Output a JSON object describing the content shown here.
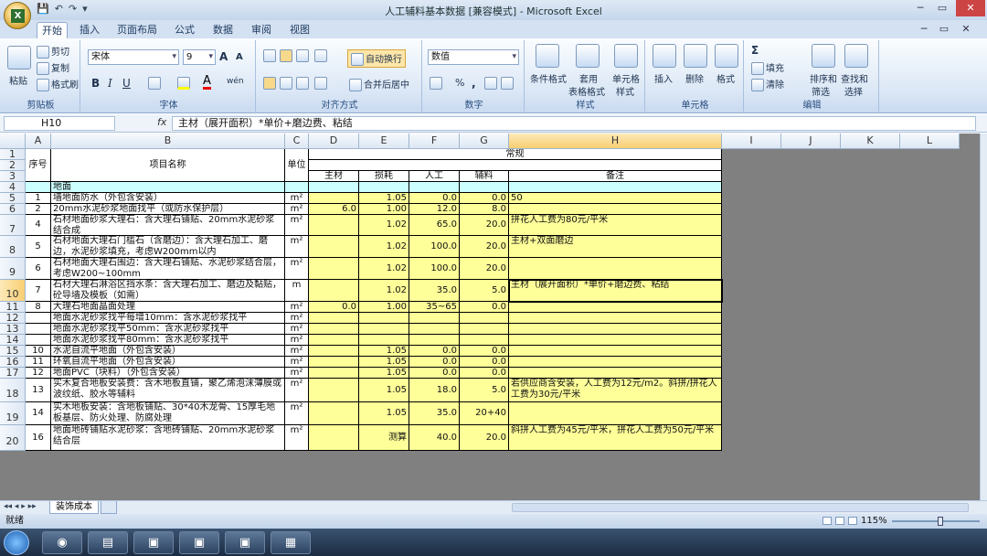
{
  "window": {
    "title": "人工辅料基本数据 [兼容模式] - Microsoft Excel",
    "office_logo": "X",
    "qat": [
      "💾",
      "↶",
      "↷",
      "▾"
    ],
    "controls": [
      "─",
      "▭",
      "✕",
      "─",
      "▭",
      "✕"
    ]
  },
  "tabs": [
    "开始",
    "插入",
    "页面布局",
    "公式",
    "数据",
    "审阅",
    "视图"
  ],
  "ribbon": {
    "clipboard": {
      "paste": "粘贴",
      "cut": "剪切",
      "copy": "复制",
      "format_painter": "格式刷",
      "label": "剪贴板"
    },
    "font": {
      "name": "宋体",
      "size": "9",
      "grow": "A",
      "shrink": "A",
      "bold": "B",
      "italic": "I",
      "underline": "U",
      "wen": "wén",
      "label": "字体"
    },
    "alignment": {
      "wrap": "自动换行",
      "merge": "合并后居中",
      "label": "对齐方式"
    },
    "number": {
      "format": "数值",
      "percent": "%",
      "comma": ",",
      "label": "数字"
    },
    "styles": {
      "conditional": "条件格式",
      "table_format_1": "套用",
      "table_format_2": "表格格式",
      "cell_style_1": "单元格",
      "cell_style_2": "样式",
      "label": "样式"
    },
    "cells": {
      "insert": "插入",
      "delete": "删除",
      "format": "格式",
      "label": "单元格"
    },
    "editing": {
      "autosum": "Σ",
      "fill": "填充",
      "clear": "清除",
      "sort_1": "排序和",
      "sort_2": "筛选",
      "find_1": "查找和",
      "find_2": "选择",
      "label": "编辑"
    }
  },
  "formula_bar": {
    "name_box": "H10",
    "fx": "fx",
    "formula": "主材（展开面积）*单价+磨边费、粘结"
  },
  "columns": [
    "A",
    "B",
    "C",
    "D",
    "E",
    "F",
    "G",
    "H",
    "I",
    "J",
    "K",
    "L"
  ],
  "rows": [
    {
      "n": "1",
      "cells": {
        "A": "序号",
        "B": "项目名称",
        "C": "单位",
        "D": "",
        "E": "",
        "F": "",
        "G": "",
        "H": "常规"
      }
    },
    {
      "n": "2",
      "cells": {}
    },
    {
      "n": "3",
      "cells": {
        "D": "主材",
        "E": "损耗",
        "F": "人工",
        "G": "辅料",
        "H": "备注"
      }
    },
    {
      "n": "4",
      "cells": {
        "A": "",
        "B": "地面",
        "C": "",
        "D": "",
        "E": "",
        "F": "",
        "G": "",
        "H": ""
      }
    },
    {
      "n": "5",
      "cells": {
        "A": "1",
        "B": "墙地面防水（外包含安装）",
        "C": "m²",
        "D": "",
        "E": "1.05",
        "F": "0.0",
        "G": "0.0",
        "H": "50"
      }
    },
    {
      "n": "6",
      "cells": {
        "A": "2",
        "B": "20mm水泥砂浆地面找平（或防水保护层）",
        "C": "m²",
        "D": "6.0",
        "E": "1.00",
        "F": "12.0",
        "G": "8.0",
        "H": ""
      }
    },
    {
      "n": "7",
      "cells": {
        "A": "4",
        "B": "石材地面砂浆大理石：含大理石铺贴、20mm水泥砂浆结合成",
        "C": "m²",
        "D": "",
        "E": "1.02",
        "F": "65.0",
        "G": "20.0",
        "H": "拼花人工费为80元/平米"
      }
    },
    {
      "n": "8",
      "cells": {
        "A": "5",
        "B": "石材地面大理石门槛石（含磨边）：含大理石加工、磨边，水泥砂浆填充，考虑W200mm以内",
        "C": "m²",
        "D": "",
        "E": "1.02",
        "F": "100.0",
        "G": "20.0",
        "H": "主材+双面磨边"
      }
    },
    {
      "n": "9",
      "cells": {
        "A": "6",
        "B": "石材地面大理石围边：含大理石铺贴、水泥砂浆结合层，考虑W200~100mm",
        "C": "m²",
        "D": "",
        "E": "1.02",
        "F": "100.0",
        "G": "20.0",
        "H": ""
      }
    },
    {
      "n": "10",
      "cells": {
        "A": "7",
        "B": "石材大理石淋浴区挡水条：含大理石加工、磨边及黏贴，砼导墙及模板（如需）",
        "C": "m",
        "D": "",
        "E": "1.02",
        "F": "35.0",
        "G": "5.0",
        "H": "主材（展开面积）*单价+磨边费、粘结"
      }
    },
    {
      "n": "11",
      "cells": {
        "A": "8",
        "B": "大理石地面晶面处理",
        "C": "m²",
        "D": "0.0",
        "E": "1.00",
        "F": "35~65",
        "G": "0.0",
        "H": ""
      }
    },
    {
      "n": "12",
      "cells": {
        "A": "",
        "B": "地面水泥砂浆找平每增10mm：含水泥砂浆找平",
        "C": "m²",
        "D": "",
        "E": "",
        "F": "",
        "G": "",
        "H": ""
      }
    },
    {
      "n": "13",
      "cells": {
        "A": "",
        "B": "地面水泥砂浆找平50mm：含水泥砂浆找平",
        "C": "m²",
        "D": "",
        "E": "",
        "F": "",
        "G": "",
        "H": ""
      }
    },
    {
      "n": "14",
      "cells": {
        "A": "",
        "B": "地面水泥砂浆找平80mm：含水泥砂浆找平",
        "C": "m²",
        "D": "",
        "E": "",
        "F": "",
        "G": "",
        "H": ""
      }
    },
    {
      "n": "15",
      "cells": {
        "A": "10",
        "B": "水泥自流平地面（外包含安装）",
        "C": "m²",
        "D": "",
        "E": "1.05",
        "F": "0.0",
        "G": "0.0",
        "H": ""
      }
    },
    {
      "n": "16",
      "cells": {
        "A": "11",
        "B": "环氧自流平地面（外包含安装）",
        "C": "m²",
        "D": "",
        "E": "1.05",
        "F": "0.0",
        "G": "0.0",
        "H": ""
      }
    },
    {
      "n": "17",
      "cells": {
        "A": "12",
        "B": "地面PVC（块料）（外包含安装）",
        "C": "m²",
        "D": "",
        "E": "1.05",
        "F": "0.0",
        "G": "0.0",
        "H": ""
      }
    },
    {
      "n": "18",
      "cells": {
        "A": "13",
        "B": "实木复合地板安装费：含木地板直铺，聚乙烯泡沫薄膜或波纹纸、胶水等辅料",
        "C": "m²",
        "D": "",
        "E": "1.05",
        "F": "18.0",
        "G": "5.0",
        "H": "若供应商含安装，人工费为12元/m2。斜拼/拼花人工费为30元/平米"
      }
    },
    {
      "n": "19",
      "cells": {
        "A": "14",
        "B": "实木地板安装：含地板铺贴、30*40木龙骨、15厚毛地板基层、防火处理、防腐处理",
        "C": "m²",
        "D": "",
        "E": "1.05",
        "F": "35.0",
        "G": "20+40",
        "H": ""
      }
    },
    {
      "n": "20",
      "cells": {
        "A": "16",
        "B": "地面地砖铺贴水泥砂浆：含地砖铺贴、20mm水泥砂浆结合层",
        "C": "m²",
        "D": "",
        "E": "测算",
        "F": "40.0",
        "G": "20.0",
        "H": "斜拼人工费为45元/平米，拼花人工费为50元/平米"
      }
    }
  ],
  "sheet_tab": "装饰成本",
  "status": {
    "ready": "就绪",
    "zoom": "115%"
  },
  "progress": {
    "zoom_percent": 115
  }
}
